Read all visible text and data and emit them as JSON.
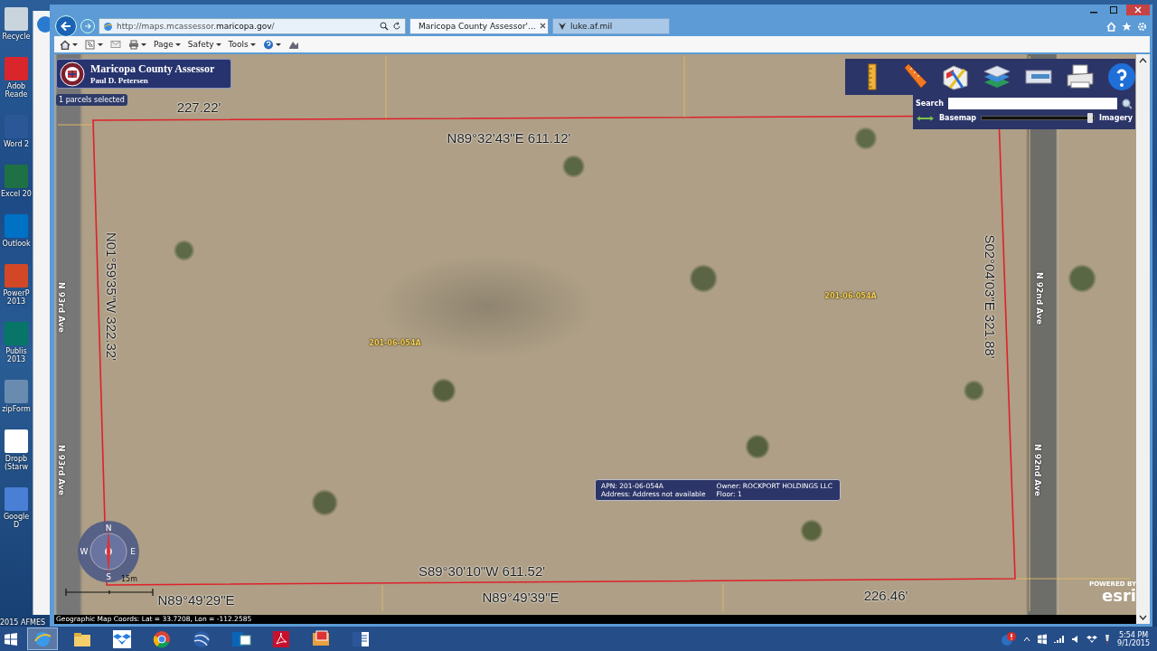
{
  "desktop": {
    "icons": [
      {
        "label": "Recycle"
      },
      {
        "label": "Adob Reade"
      },
      {
        "label": "Word 2"
      },
      {
        "label": "Excel 20"
      },
      {
        "label": "Outlook"
      },
      {
        "label": "PowerP 2013"
      },
      {
        "label": "Publis 2013"
      },
      {
        "label": "zipForm"
      },
      {
        "label": "Dropb (Starw"
      },
      {
        "label": "Google D"
      }
    ],
    "footer_text": "2015 AFMES"
  },
  "browser": {
    "address": "http://maps.mcassessor.**maricopa.gov**/",
    "tabs": [
      {
        "label": "Maricopa County Assessor'...",
        "selected": true
      },
      {
        "label": "luke.af.mil",
        "selected": false
      }
    ],
    "command_bar": [
      "Page",
      "Safety",
      "Tools"
    ]
  },
  "map": {
    "header": {
      "title": "Maricopa County Assessor",
      "subtitle": "Paul D. Petersen"
    },
    "selection_badge": "1 parcels selected",
    "search": {
      "label": "Search"
    },
    "basemap": {
      "left_label": "Basemap",
      "right_label": "Imagery",
      "level": 0.97
    },
    "labels": [
      {
        "kind": "bearing",
        "text": "227.22'"
      },
      {
        "kind": "bearing",
        "text": "N89°32'43\"E 611.12'"
      },
      {
        "kind": "bearing",
        "text": "N01°59'35\"W 322.32'"
      },
      {
        "kind": "bearing",
        "text": "S02°04'03\"E 321.88'"
      },
      {
        "kind": "parcel",
        "text": "201-06-054A"
      },
      {
        "kind": "parcel",
        "text": "201-06-054A"
      },
      {
        "kind": "street",
        "text": "N 93rd Ave"
      },
      {
        "kind": "street",
        "text": "N 93rd Ave"
      },
      {
        "kind": "street",
        "text": "N 92nd Ave"
      },
      {
        "kind": "street",
        "text": "N 92nd Ave"
      },
      {
        "kind": "bearing",
        "text": "S89°30'10\"W 611.52'"
      },
      {
        "kind": "bearing",
        "text": "N89°49'29\"E"
      },
      {
        "kind": "bearing",
        "text": "N89°49'39\"E"
      },
      {
        "kind": "bearing",
        "text": "226.46'"
      }
    ],
    "popup": {
      "fields": [
        "APN: 201-06-054A",
        "Owner: ROCKPORT HOLDINGS LLC",
        "Address: Address not available",
        "Floor: 1"
      ]
    },
    "compass": {
      "north": "N",
      "south": "S",
      "east": "E",
      "west": "W"
    },
    "scale": "15m",
    "attribution": {
      "small": "POWERED BY",
      "brand": "esri"
    }
  },
  "status_bar": "Geographic Map Coords: Lat = 33.7208, Lon = -112.2585",
  "taskbar": {
    "apps": [
      {
        "kind": "ie",
        "selected": true
      },
      {
        "kind": "explorer",
        "selected": false
      },
      {
        "kind": "dropbox",
        "selected": false
      },
      {
        "kind": "chrome",
        "selected": false
      },
      {
        "kind": "earth",
        "selected": false
      },
      {
        "kind": "outlook",
        "selected": false
      },
      {
        "kind": "acrobat",
        "selected": false
      },
      {
        "kind": "viewer",
        "selected": false
      },
      {
        "kind": "word",
        "selected": false
      }
    ],
    "time": "5:54 PM",
    "date": "9/1/2015"
  }
}
